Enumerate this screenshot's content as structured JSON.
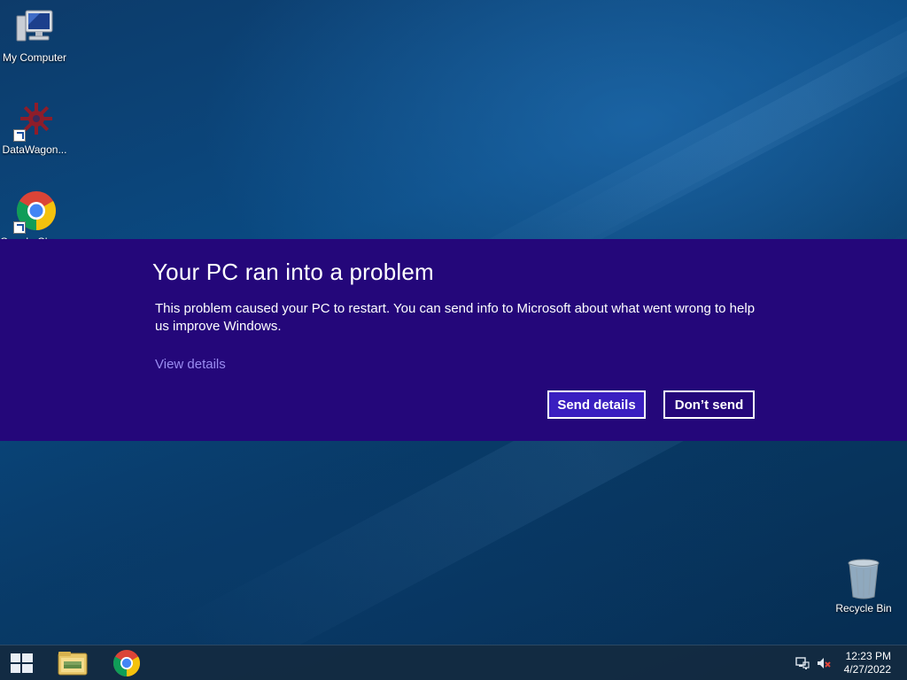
{
  "desktop": {
    "icons": [
      {
        "label": "My Computer"
      },
      {
        "label": "DataWagon..."
      },
      {
        "label": "Google Chrome"
      },
      {
        "label": "Recycle Bin"
      }
    ]
  },
  "error_dialog": {
    "title": "Your PC ran into a problem",
    "message": "This problem caused your PC to restart. You can send info to Microsoft about what went wrong to help us improve Windows.",
    "view_details_label": "View details",
    "send_details_label": "Send details",
    "dont_send_label": "Don’t send",
    "background_color": "#24077a",
    "primary_button_color": "#3a1fc0",
    "link_color": "#9a8cf2"
  },
  "taskbar": {
    "items": [
      {
        "icon": "windows-start-icon"
      },
      {
        "icon": "file-explorer-icon"
      },
      {
        "icon": "chrome-icon"
      }
    ],
    "tray": {
      "icons": [
        "network-icon",
        "volume-muted-icon"
      ],
      "time": "12:23 PM",
      "date": "4/27/2022"
    }
  }
}
